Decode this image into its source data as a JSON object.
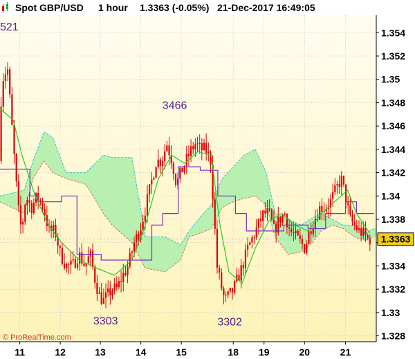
{
  "header": {
    "icon": "candlestick-icon",
    "instrument": "Spot GBP/USD",
    "timeframe": "1 hour",
    "quote": "1.3363 (-0.05%)",
    "datetime": "21-Dec-2017 16:49:05"
  },
  "copyright": "© ProRealTime.com",
  "colors": {
    "background_top": "#fffdf0",
    "background_bottom": "#fdf3b8",
    "candle": "#e00000",
    "kijun": "#7b2fbf",
    "tenkan": "#22cc22",
    "cloud_bull": "#b8f0b0",
    "cloud_bear": "#ffc8e6",
    "last_price_bg": "#f2cc10"
  },
  "chart_data": {
    "type": "candlestick",
    "indicator": "ichimoku",
    "ylim": [
      1.3275,
      1.3555
    ],
    "y_ticks": [
      "1.354",
      "1.352",
      "1.35",
      "1.348",
      "1.346",
      "1.344",
      "1.342",
      "1.34",
      "1.338",
      "1.336",
      "1.334",
      "1.332",
      "1.33",
      "1.328"
    ],
    "x_ticks": [
      {
        "label": "11",
        "x": 0.45
      },
      {
        "label": "12",
        "x": 1.37
      },
      {
        "label": "13",
        "x": 2.28
      },
      {
        "label": "14",
        "x": 3.2
      },
      {
        "label": "15",
        "x": 4.12
      },
      {
        "label": "18",
        "x": 5.3
      },
      {
        "label": "19",
        "x": 6.0
      },
      {
        "label": "20",
        "x": 6.92
      },
      {
        "label": "21",
        "x": 7.85
      }
    ],
    "x_range": [
      0,
      8.55
    ],
    "price_path": [
      [
        0.0,
        1.343
      ],
      [
        0.1,
        1.35
      ],
      [
        0.22,
        1.351
      ],
      [
        0.3,
        1.347
      ],
      [
        0.38,
        1.343
      ],
      [
        0.46,
        1.339
      ],
      [
        0.54,
        1.337
      ],
      [
        0.64,
        1.34
      ],
      [
        0.76,
        1.339
      ],
      [
        0.9,
        1.34
      ],
      [
        1.04,
        1.339
      ],
      [
        1.16,
        1.337
      ],
      [
        1.3,
        1.337
      ],
      [
        1.42,
        1.335
      ],
      [
        1.56,
        1.334
      ],
      [
        1.7,
        1.334
      ],
      [
        1.84,
        1.335
      ],
      [
        1.98,
        1.334
      ],
      [
        2.1,
        1.335
      ],
      [
        2.2,
        1.333
      ],
      [
        2.3,
        1.3315
      ],
      [
        2.4,
        1.331
      ],
      [
        2.5,
        1.3315
      ],
      [
        2.6,
        1.332
      ],
      [
        2.7,
        1.332
      ],
      [
        2.82,
        1.333
      ],
      [
        2.96,
        1.334
      ],
      [
        3.1,
        1.336
      ],
      [
        3.22,
        1.337
      ],
      [
        3.36,
        1.339
      ],
      [
        3.48,
        1.341
      ],
      [
        3.6,
        1.343
      ],
      [
        3.72,
        1.343
      ],
      [
        3.84,
        1.3445
      ],
      [
        3.96,
        1.343
      ],
      [
        4.06,
        1.341
      ],
      [
        4.16,
        1.342
      ],
      [
        4.28,
        1.343
      ],
      [
        4.4,
        1.344
      ],
      [
        4.5,
        1.3445
      ],
      [
        4.6,
        1.344
      ],
      [
        4.72,
        1.344
      ],
      [
        4.84,
        1.343
      ],
      [
        4.92,
        1.338
      ],
      [
        4.98,
        1.334
      ],
      [
        5.06,
        1.3325
      ],
      [
        5.16,
        1.331
      ],
      [
        5.26,
        1.3315
      ],
      [
        5.36,
        1.332
      ],
      [
        5.46,
        1.333
      ],
      [
        5.56,
        1.334
      ],
      [
        5.68,
        1.3355
      ],
      [
        5.8,
        1.3365
      ],
      [
        5.92,
        1.3375
      ],
      [
        6.04,
        1.3385
      ],
      [
        6.16,
        1.3385
      ],
      [
        6.28,
        1.337
      ],
      [
        6.4,
        1.338
      ],
      [
        6.52,
        1.3385
      ],
      [
        6.64,
        1.337
      ],
      [
        6.76,
        1.3365
      ],
      [
        6.88,
        1.336
      ],
      [
        6.98,
        1.3355
      ],
      [
        7.08,
        1.337
      ],
      [
        7.2,
        1.338
      ],
      [
        7.32,
        1.339
      ],
      [
        7.44,
        1.339
      ],
      [
        7.56,
        1.3395
      ],
      [
        7.68,
        1.3405
      ],
      [
        7.8,
        1.3415
      ],
      [
        7.9,
        1.34
      ],
      [
        8.0,
        1.338
      ],
      [
        8.1,
        1.3375
      ],
      [
        8.2,
        1.337
      ],
      [
        8.3,
        1.3368
      ],
      [
        8.4,
        1.3363
      ]
    ],
    "tenkan": [
      [
        0.0,
        1.3475
      ],
      [
        0.3,
        1.3465
      ],
      [
        0.5,
        1.3435
      ],
      [
        0.8,
        1.34
      ],
      [
        1.1,
        1.3375
      ],
      [
        1.4,
        1.336
      ],
      [
        1.8,
        1.3345
      ],
      [
        2.2,
        1.3338
      ],
      [
        2.6,
        1.3332
      ],
      [
        3.0,
        1.3345
      ],
      [
        3.3,
        1.3375
      ],
      [
        3.6,
        1.3415
      ],
      [
        3.9,
        1.3435
      ],
      [
        4.2,
        1.3428
      ],
      [
        4.5,
        1.3438
      ],
      [
        4.8,
        1.3435
      ],
      [
        5.0,
        1.3375
      ],
      [
        5.2,
        1.3335
      ],
      [
        5.5,
        1.3325
      ],
      [
        5.8,
        1.3355
      ],
      [
        6.1,
        1.3378
      ],
      [
        6.4,
        1.3385
      ],
      [
        6.7,
        1.3375
      ],
      [
        7.0,
        1.337
      ],
      [
        7.3,
        1.3385
      ],
      [
        7.6,
        1.3395
      ],
      [
        7.9,
        1.3405
      ],
      [
        8.1,
        1.3385
      ],
      [
        8.4,
        1.3368
      ]
    ],
    "kijun": [
      [
        0.0,
        1.3423
      ],
      [
        0.68,
        1.3423
      ],
      [
        0.68,
        1.34
      ],
      [
        0.86,
        1.34
      ],
      [
        0.86,
        1.3395
      ],
      [
        1.4,
        1.3395
      ],
      [
        1.4,
        1.34
      ],
      [
        1.75,
        1.34
      ],
      [
        1.75,
        1.335
      ],
      [
        2.3,
        1.335
      ],
      [
        2.3,
        1.3345
      ],
      [
        2.9,
        1.3345
      ],
      [
        2.9,
        1.3345
      ],
      [
        3.45,
        1.3345
      ],
      [
        3.45,
        1.3375
      ],
      [
        3.7,
        1.3375
      ],
      [
        3.7,
        1.3385
      ],
      [
        4.05,
        1.3385
      ],
      [
        4.05,
        1.3425
      ],
      [
        4.55,
        1.3425
      ],
      [
        4.55,
        1.3422
      ],
      [
        4.95,
        1.3422
      ],
      [
        4.95,
        1.34
      ],
      [
        5.35,
        1.34
      ],
      [
        5.35,
        1.3385
      ],
      [
        5.6,
        1.3385
      ],
      [
        5.6,
        1.337
      ],
      [
        6.05,
        1.337
      ],
      [
        6.05,
        1.337
      ],
      [
        6.45,
        1.337
      ],
      [
        6.45,
        1.3375
      ],
      [
        7.0,
        1.3375
      ],
      [
        7.0,
        1.3372
      ],
      [
        7.4,
        1.3372
      ],
      [
        7.4,
        1.3385
      ],
      [
        7.85,
        1.3385
      ],
      [
        7.85,
        1.3395
      ],
      [
        8.1,
        1.3395
      ],
      [
        8.1,
        1.3385
      ],
      [
        8.5,
        1.3385
      ]
    ],
    "cloud_upper": [
      [
        0.0,
        1.34
      ],
      [
        0.55,
        1.3405
      ],
      [
        0.75,
        1.343
      ],
      [
        1.0,
        1.3455
      ],
      [
        1.2,
        1.345
      ],
      [
        1.5,
        1.342
      ],
      [
        1.95,
        1.342
      ],
      [
        2.35,
        1.3435
      ],
      [
        2.55,
        1.3433
      ],
      [
        3.0,
        1.3433
      ],
      [
        3.3,
        1.3365
      ],
      [
        3.75,
        1.3365
      ],
      [
        4.1,
        1.3358
      ],
      [
        4.3,
        1.337
      ],
      [
        4.55,
        1.3382
      ],
      [
        4.8,
        1.3392
      ],
      [
        5.05,
        1.3415
      ],
      [
        5.3,
        1.3425
      ],
      [
        5.55,
        1.3435
      ],
      [
        5.8,
        1.344
      ],
      [
        6.05,
        1.342
      ],
      [
        6.25,
        1.3385
      ],
      [
        6.55,
        1.338
      ],
      [
        6.85,
        1.3375
      ],
      [
        7.05,
        1.338
      ],
      [
        7.3,
        1.3385
      ],
      [
        7.55,
        1.338
      ],
      [
        7.8,
        1.3375
      ],
      [
        8.05,
        1.3375
      ],
      [
        8.3,
        1.3368
      ],
      [
        8.5,
        1.3372
      ]
    ],
    "cloud_lower": [
      [
        0.0,
        1.3395
      ],
      [
        0.55,
        1.3385
      ],
      [
        0.75,
        1.3415
      ],
      [
        1.0,
        1.343
      ],
      [
        1.2,
        1.342
      ],
      [
        1.5,
        1.3415
      ],
      [
        1.95,
        1.341
      ],
      [
        2.35,
        1.3385
      ],
      [
        2.55,
        1.3375
      ],
      [
        3.0,
        1.336
      ],
      [
        3.3,
        1.3338
      ],
      [
        3.75,
        1.3335
      ],
      [
        4.1,
        1.3345
      ],
      [
        4.3,
        1.3365
      ],
      [
        4.55,
        1.3368
      ],
      [
        4.8,
        1.3372
      ],
      [
        5.05,
        1.339
      ],
      [
        5.3,
        1.3395
      ],
      [
        5.55,
        1.3398
      ],
      [
        5.8,
        1.34
      ],
      [
        6.05,
        1.3392
      ],
      [
        6.25,
        1.3365
      ],
      [
        6.55,
        1.335
      ],
      [
        6.85,
        1.3352
      ],
      [
        7.05,
        1.3358
      ],
      [
        7.3,
        1.337
      ],
      [
        7.55,
        1.3375
      ],
      [
        7.8,
        1.3372
      ],
      [
        8.05,
        1.3365
      ],
      [
        8.3,
        1.3362
      ],
      [
        8.5,
        1.3365
      ]
    ],
    "annotations": [
      {
        "label": "3466",
        "x": 3.97,
        "y": 1.347,
        "anchor": "above"
      },
      {
        "label": "3303",
        "x": 2.4,
        "y": 1.3303,
        "anchor": "below"
      },
      {
        "label": "3302",
        "x": 5.22,
        "y": 1.3302,
        "anchor": "below"
      },
      {
        "label": "521",
        "x": 0.05,
        "y": 1.3521,
        "anchor": "left"
      }
    ],
    "last_price": "1.3363",
    "last_price_value": 1.3363
  }
}
